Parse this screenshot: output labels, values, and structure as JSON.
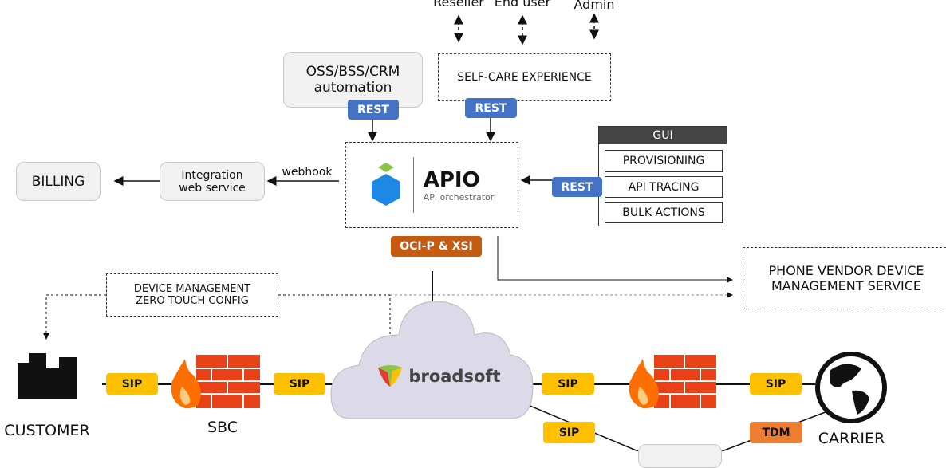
{
  "actors": [
    "Reseller",
    "End user",
    "Admin"
  ],
  "oss": "OSS/BSS/CRM automation",
  "selfcare": "SELF-CARE EXPERIENCE",
  "rest": "REST",
  "apio": {
    "title": "APIO",
    "subtitle": "API orchestrator"
  },
  "gui": {
    "header": "GUI",
    "items": [
      "PROVISIONING",
      "API TRACING",
      "BULK ACTIONS"
    ]
  },
  "billing": "BILLING",
  "integration": "Integration web service",
  "webhook": "webhook",
  "ocip": "OCI-P & XSI",
  "phone_vendor": "PHONE VENDOR DEVICE MANAGEMENT SERVICE",
  "device_mgmt": "DEVICE MANAGEMENT ZERO TOUCH CONFIG",
  "broadsoft": "broadsoft",
  "sip": "SIP",
  "tdm": "TDM",
  "customer": "CUSTOMER",
  "sbc": "SBC",
  "carrier": "CARRIER",
  "colors": {
    "rest": "#4472c4",
    "sip": "#ffc000",
    "ocip": "#c55a11",
    "tdm": "#ed7d31",
    "cloud": "#dcdae8"
  }
}
